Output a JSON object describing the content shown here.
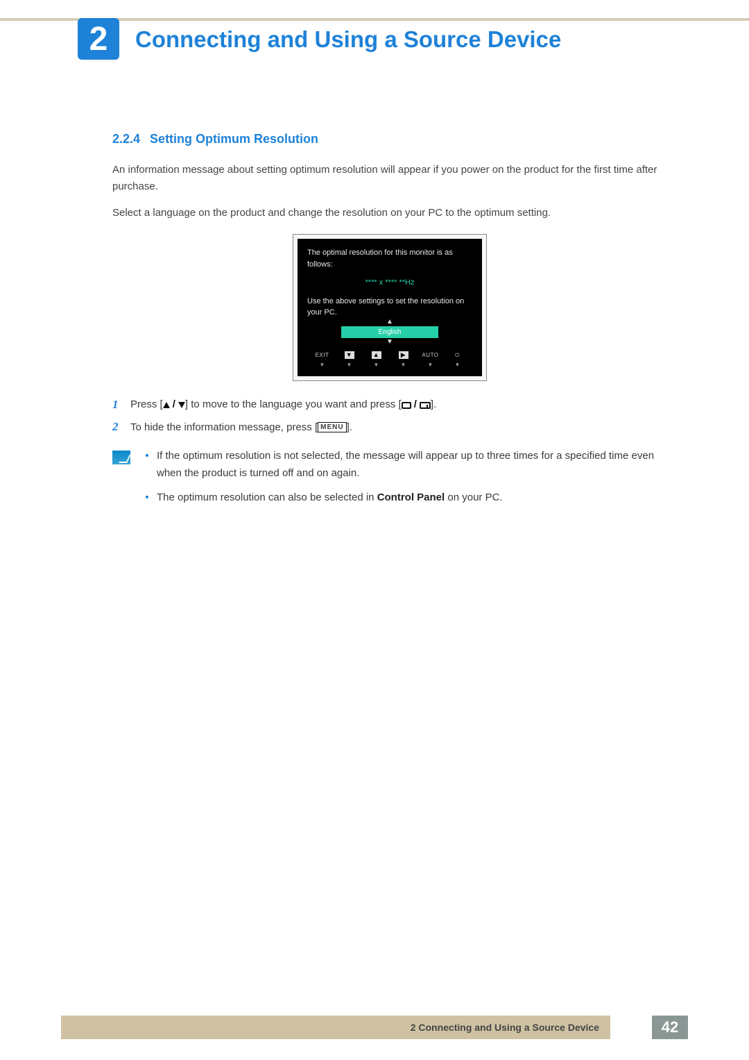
{
  "header": {
    "chapter_number": "2",
    "chapter_title": "Connecting and Using a Source Device"
  },
  "section": {
    "number": "2.2.4",
    "title": "Setting Optimum Resolution",
    "para1": "An information message about setting optimum resolution will appear if you power on the product for the first time after purchase.",
    "para2": "Select a language on the product and change the resolution on your PC to the optimum setting."
  },
  "osd": {
    "line1": "The optimal resolution for this monitor is as follows:",
    "resolution": "**** x ****  **Hz",
    "line2": "Use the above settings to set the resolution on your PC.",
    "language": "English",
    "buttons": {
      "exit": "EXIT",
      "auto": "AUTO"
    }
  },
  "steps": [
    {
      "n": "1",
      "pre": "Press [",
      "mid": "] to move to the language you want and press [",
      "post": "]."
    },
    {
      "n": "2",
      "pre": "To hide the information message, press [",
      "post": "]."
    }
  ],
  "note": {
    "bullet1": "If the optimum resolution is not selected, the message will appear up to three times for a specified time even when the product is turned off and on again.",
    "bullet2_pre": "The optimum resolution can also be selected in ",
    "bullet2_bold": "Control Panel",
    "bullet2_post": " on your PC."
  },
  "menu_label": "MENU",
  "footer": {
    "label_prefix": "2 ",
    "label": "Connecting and Using a Source Device",
    "page": "42"
  }
}
